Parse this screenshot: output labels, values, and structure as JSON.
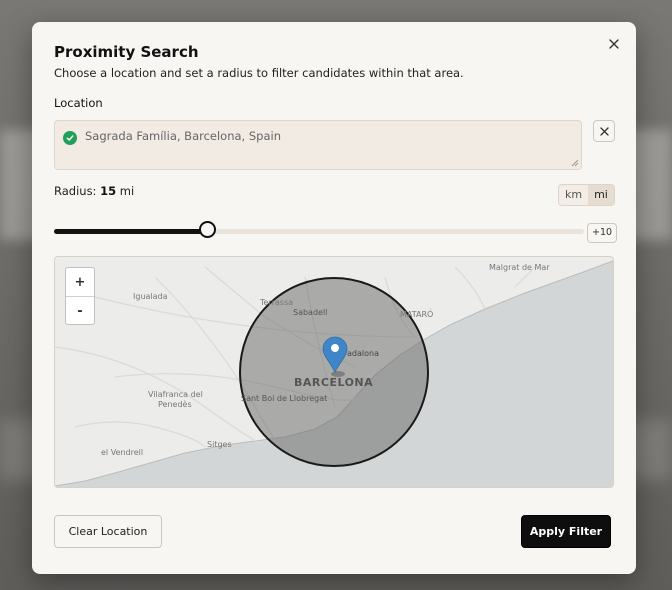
{
  "modal": {
    "title": "Proximity Search",
    "description": "Choose a location and set a radius to filter candidates within that area."
  },
  "location": {
    "label": "Location",
    "value": "Sagrada Família, Barcelona, Spain"
  },
  "radius": {
    "label": "Radius:",
    "value": "15",
    "unit": "mi",
    "slider_fraction": 0.29,
    "step_label": "+10",
    "units": [
      {
        "label": "km",
        "active": false
      },
      {
        "label": "mi",
        "active": true
      }
    ]
  },
  "map": {
    "zoom_in": "+",
    "zoom_out": "-",
    "places": {
      "malgrat": "Malgrat de Mar",
      "igualada": "Igualada",
      "terrassa": "Terrassa",
      "sabadell": "Sabadell",
      "mataro": "MATARÓ",
      "badalona": "adalona",
      "barcelona": "BARCELONA",
      "vilafranca1": "Vilafranca del",
      "vilafranca2": "Penedès",
      "santboi": "Sant Boi de Llobregat",
      "sitges": "Sitges",
      "vendrell": "el Vendrell"
    }
  },
  "actions": {
    "clear_label": "Clear Location",
    "apply_label": "Apply Filter"
  },
  "colors": {
    "accent_dark": "#0e0e0e",
    "success": "#22a05a",
    "pin": "#3f86c8"
  }
}
